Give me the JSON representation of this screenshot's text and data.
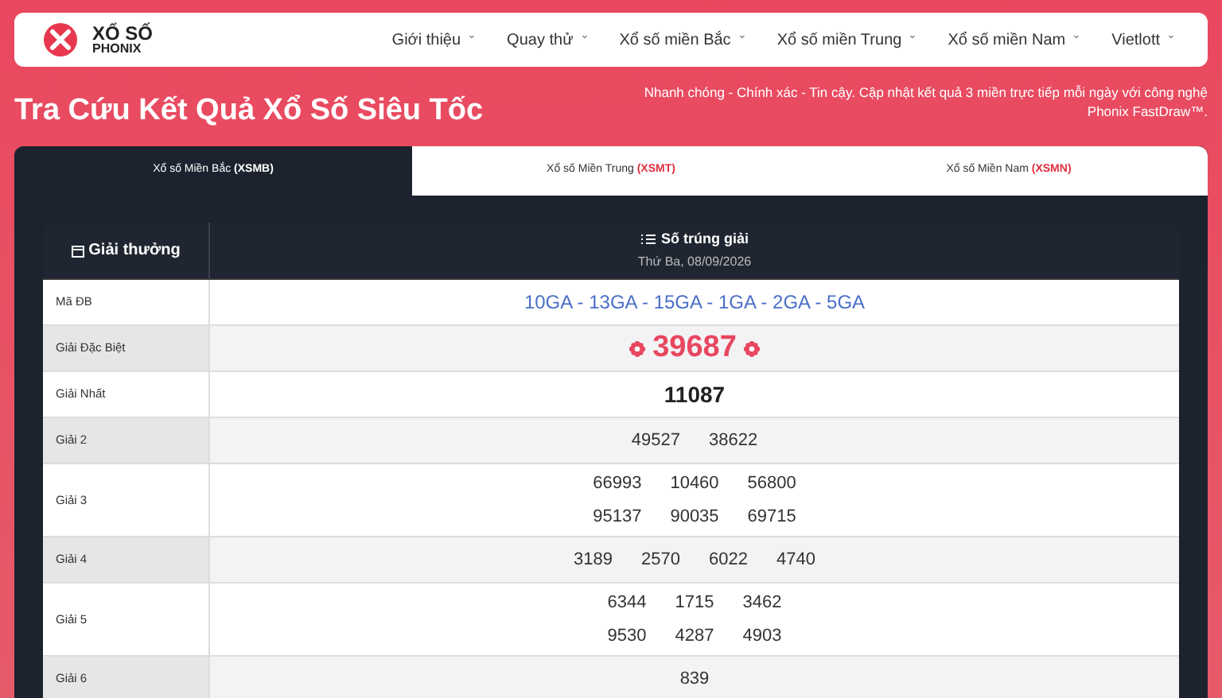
{
  "logo": {
    "line1": "XỔ SỐ",
    "line2": "PHONIX"
  },
  "nav": [
    {
      "label": "Giới thiệu",
      "caret": "⌄"
    },
    {
      "label": "Quay thử",
      "caret": "⌄"
    },
    {
      "label": "Xổ số miền Bắc",
      "caret": "⌄"
    },
    {
      "label": "Xổ số miền Trung",
      "caret": "⌄"
    },
    {
      "label": "Xổ số miền Nam",
      "caret": "⌄"
    },
    {
      "label": "Vietlott",
      "caret": "⌄"
    }
  ],
  "hero": {
    "title": "Tra Cứu Kết Quả Xổ Số Siêu Tốc",
    "tagline": "Nhanh chóng - Chính xác - Tin cậy. Cập nhật kết quả 3 miền trực tiếp mỗi ngày với công nghệ Phonix FastDraw™."
  },
  "tabs": [
    {
      "label": "Xổ số Miền Bắc",
      "code": "(XSMB)",
      "selected": true
    },
    {
      "label": "Xổ số Miền Trung",
      "code": "(XSMT)",
      "selected": false
    },
    {
      "label": "Xổ số Miền Nam",
      "code": "(XSMN)",
      "selected": false
    }
  ],
  "table": {
    "columns": [
      {
        "label": "Giải thưởng"
      },
      {
        "label": "Số trúng giải",
        "sub": "Thứ Ba, 08/09/2026"
      }
    ],
    "rows": [
      {
        "kind": "code",
        "label": "Mã ĐB",
        "lines": [
          [
            "10GA - 13GA - 15GA - 1GA - 2GA - 5GA"
          ]
        ]
      },
      {
        "kind": "special",
        "label": "Giải Đặc Biệt",
        "lines": [
          [
            "39687"
          ]
        ]
      },
      {
        "kind": "first",
        "label": "Giải Nhất",
        "lines": [
          [
            "11087"
          ]
        ]
      },
      {
        "kind": "plain",
        "label": "Giải 2",
        "lines": [
          [
            "49527",
            "38622"
          ]
        ]
      },
      {
        "kind": "plain",
        "label": "Giải 3",
        "lines": [
          [
            "66993",
            "10460",
            "56800"
          ],
          [
            "95137",
            "90035",
            "69715"
          ]
        ]
      },
      {
        "kind": "plain",
        "label": "Giải 4",
        "lines": [
          [
            "3189",
            "2570",
            "6022",
            "4740"
          ]
        ]
      },
      {
        "kind": "plain",
        "label": "Giải 5",
        "lines": [
          [
            "6344",
            "1715",
            "3462"
          ],
          [
            "9530",
            "4287",
            "4903"
          ]
        ]
      },
      {
        "kind": "plain",
        "label": "Giải 6",
        "lines": [
          [
            "839"
          ]
        ]
      }
    ]
  }
}
